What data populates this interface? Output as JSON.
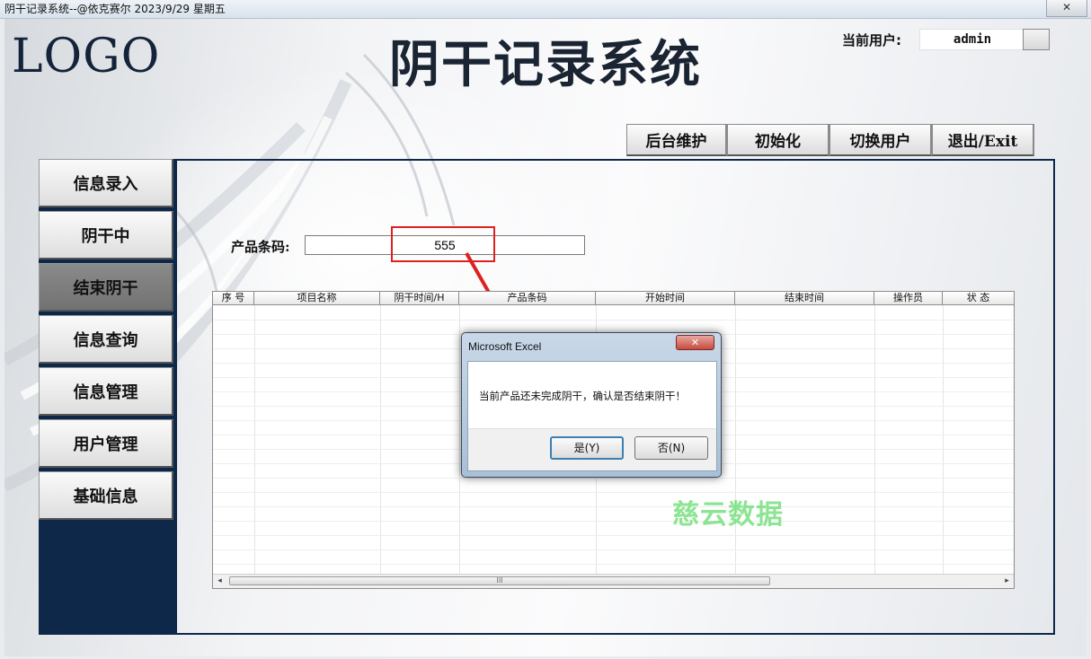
{
  "window": {
    "title": "阴干记录系统--@依克赛尔  2023/9/29 星期五",
    "close_glyph": "✕"
  },
  "header": {
    "logo": "LOGO",
    "app_title": "阴干记录系统",
    "user_label": "当前用户:",
    "user_value": "admin"
  },
  "toolbar": {
    "buttons": [
      "后台维护",
      "初始化",
      "切换用户",
      "退出/Exit"
    ]
  },
  "sidebar": {
    "items": [
      "信息录入",
      "阴干中",
      "结束阴干",
      "信息查询",
      "信息管理",
      "用户管理",
      "基础信息"
    ],
    "active": "结束阴干"
  },
  "form": {
    "barcode_label": "产品条码:",
    "barcode_value": "555"
  },
  "grid": {
    "columns": [
      "序 号",
      "项目名称",
      "阴干时间/H",
      "产品条码",
      "开始时间",
      "结束时间",
      "操作员",
      "状 态"
    ],
    "rows": [],
    "scroll_left": "◂",
    "scroll_right": "▸",
    "scroll_thumb_grip": "III"
  },
  "dialog": {
    "title": "Microsoft Excel",
    "close_glyph": "✕",
    "message": "当前产品还未完成阴干，确认是否结束阴干！",
    "yes_label": "是(Y)",
    "no_label": "否(N)"
  },
  "watermark": "慈云数据",
  "colors": {
    "nav_dark": "#0d2849",
    "highlight": "#e02020",
    "watermark": "#64dc6e"
  }
}
